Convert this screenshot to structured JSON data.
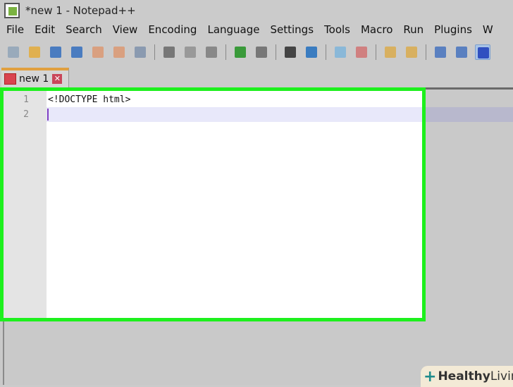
{
  "window": {
    "title": "*new 1 - Notepad++"
  },
  "menu": [
    "File",
    "Edit",
    "Search",
    "View",
    "Encoding",
    "Language",
    "Settings",
    "Tools",
    "Macro",
    "Run",
    "Plugins",
    "W"
  ],
  "toolbar": [
    {
      "icon": "new-file-icon",
      "color": "#9ab"
    },
    {
      "icon": "open-file-icon",
      "color": "#e0b050"
    },
    {
      "icon": "save-icon",
      "color": "#4a7cc0"
    },
    {
      "icon": "save-all-icon",
      "color": "#4a7cc0"
    },
    {
      "icon": "close-icon",
      "color": "#d9a080"
    },
    {
      "icon": "close-all-icon",
      "color": "#d9a080"
    },
    {
      "icon": "print-icon",
      "color": "#8a9ab0"
    },
    {
      "sep": true
    },
    {
      "icon": "cut-icon",
      "color": "#777"
    },
    {
      "icon": "copy-icon",
      "color": "#999"
    },
    {
      "icon": "paste-icon",
      "color": "#888"
    },
    {
      "sep": true
    },
    {
      "icon": "undo-icon",
      "color": "#3a9a3a"
    },
    {
      "icon": "redo-icon",
      "color": "#777"
    },
    {
      "sep": true
    },
    {
      "icon": "find-icon",
      "color": "#444"
    },
    {
      "icon": "replace-icon",
      "color": "#3a7cc0"
    },
    {
      "sep": true
    },
    {
      "icon": "zoom-in-icon",
      "color": "#8ab8d8"
    },
    {
      "icon": "zoom-out-icon",
      "color": "#d08080"
    },
    {
      "sep": true
    },
    {
      "icon": "sync-vertical-icon",
      "color": "#d8b060"
    },
    {
      "icon": "sync-horizontal-icon",
      "color": "#d8b060"
    },
    {
      "sep": true
    },
    {
      "icon": "word-wrap-icon",
      "color": "#5a80c0"
    },
    {
      "icon": "show-all-chars-icon",
      "color": "#5a80c0"
    },
    {
      "icon": "indent-guide-icon",
      "color": "#3050c0",
      "active": true
    }
  ],
  "tab": {
    "label": "new 1",
    "close": "✕"
  },
  "editor": {
    "lines": [
      {
        "num": "1",
        "text": "<!DOCTYPE html>"
      },
      {
        "num": "2",
        "text": ""
      }
    ]
  },
  "watermark": {
    "plus": "+",
    "bold": "Healthy",
    "rest": " Living"
  }
}
